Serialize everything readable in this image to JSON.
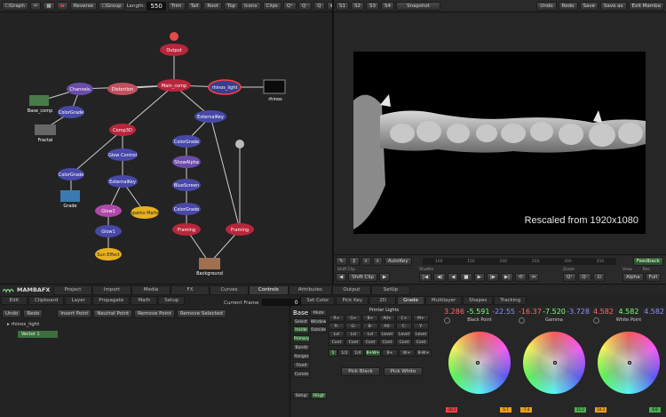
{
  "node_toolbar": {
    "graph_label": "Graph",
    "reverse_label": "Reverse",
    "group_label": "Group",
    "length_label": "Length:",
    "length_value": "550",
    "buttons": [
      "Trim",
      "Tail",
      "Root",
      "Top",
      "Icons",
      "Clips"
    ]
  },
  "viewer_toolbar": {
    "tabs": [
      "S1",
      "S2",
      "S3",
      "S4"
    ],
    "snapshot_label": "Snapshot",
    "right_buttons": [
      "Undo",
      "Redo",
      "Save",
      "Save as",
      "Exit Mamba"
    ]
  },
  "nodes": {
    "output": "Output",
    "main_comp": "Main_comp",
    "rhinos_light": "rhinos_light",
    "rhinos": "rhinos",
    "channels": "Channels",
    "distortion": "Distortion",
    "base_comp": "Base_comp",
    "colorgrade": "ColorGrade",
    "fractal": "Fractal",
    "comp3d": "Comp3D",
    "externalkey": "ExternalKey",
    "glow_control": "Glow Control",
    "showalpha": "ShowAlpha",
    "bluescreen": "BlueScreen",
    "grade": "Grade",
    "glow2": "Glow2",
    "sparks_matte": "Sparks Matte",
    "glow1": "Glow1",
    "sun_effect": "Sun Effect",
    "framing": "Framing",
    "background": "Background"
  },
  "viewer": {
    "overlay_text": "Rescaled from 1920x1080"
  },
  "timeline": {
    "autokey_label": "AutoKey",
    "shift_clip_label": "Shift Clip",
    "shuttle_label": "Shuttle",
    "zoom_label": "Zoom",
    "view_label": "View",
    "res_label": "Res",
    "alpha_label": "Alpha",
    "full_label": "Full",
    "feedback_label": "Feedback",
    "ticks": [
      "100",
      "150",
      "200",
      "250",
      "300",
      "350"
    ]
  },
  "brand": "MAMBAFX",
  "main_tabs": [
    "Project",
    "Import",
    "Media",
    "FX",
    "Curves",
    "Controls",
    "Attributes",
    "Output",
    "SetUp"
  ],
  "main_tab_active": "Controls",
  "sub_tabs": [
    "Edit",
    "Clipboard",
    "Layer",
    "Propagate",
    "Math",
    "Setup"
  ],
  "current_frame_label": "Current Frame",
  "current_frame_value": "0",
  "right_tabs": [
    "Set Color",
    "Pick Key",
    "2D",
    "Grade",
    "Multilayer",
    "Shapes",
    "Tracking"
  ],
  "right_tab_active": "Grade",
  "actions": [
    "Undo",
    "Redo",
    "Insert Point",
    "Neutral Point",
    "Remove Point",
    "Remove Selected"
  ],
  "layer_name": "rhinos_light",
  "vector_name": "Vector 1",
  "grade": {
    "base_label": "Base",
    "mute_label": "Mute",
    "side_buttons": [
      "Select",
      "Window",
      "Inside",
      "Outside",
      "Primary",
      "Bands",
      "Ranges",
      "Fixed",
      "Curves"
    ],
    "setup_label": "Setup",
    "hilight_label": "HiLgt",
    "printer_lights_title": "Printer Lights",
    "printer_grid": [
      "R+",
      "G+",
      "B+",
      "All+",
      "C+",
      "M+",
      "R-",
      "G-",
      "B-",
      "All-",
      "C-",
      "Y-",
      "Lvl",
      "Lvl",
      "Lvl",
      "Level",
      "Level",
      "Level",
      "Cont",
      "Cont",
      "Cont",
      "Cont",
      "Cont",
      "Cont"
    ],
    "step_buttons": [
      "1",
      "1/2",
      "1/4",
      "B+W+",
      "B+",
      "W+",
      "B-W+"
    ],
    "pick_black": "Pick Black",
    "pick_white": "Pick White",
    "wheels": [
      {
        "title": "Black Point",
        "r": "3.286",
        "g": "-5.591",
        "b": "-22.55",
        "low": "-10.1",
        "high": "5.7"
      },
      {
        "title": "Gamma",
        "r": "-16.37",
        "g": "-7.520",
        "b": "-3.728",
        "low": "-7.4",
        "high": "11.2"
      },
      {
        "title": "White Point",
        "r": "4.582",
        "g": "4.582",
        "b": "4.582",
        "low": "10.3",
        "high": "6.8"
      }
    ]
  }
}
